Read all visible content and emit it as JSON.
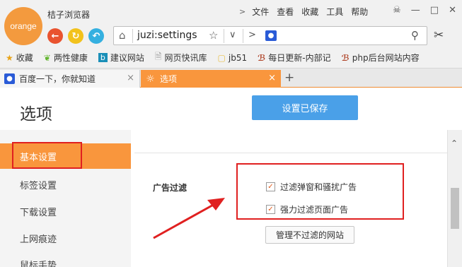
{
  "app": {
    "logo_text": "orange",
    "title": "桔子浏览器"
  },
  "menu": {
    "items": [
      "文件",
      "查看",
      "收藏",
      "工具",
      "帮助"
    ]
  },
  "address_bar": {
    "url": "juzi:settings",
    "search_placeholder": ""
  },
  "bookmarks": [
    {
      "label": "收藏",
      "icon": "star-icon",
      "color": "#e8a317"
    },
    {
      "label": "两性健康",
      "icon": "leaf-icon",
      "color": "#63b52f"
    },
    {
      "label": "建议网站",
      "icon": "bing-icon",
      "color": "#1a8fb8"
    },
    {
      "label": "网页快讯库",
      "icon": "page-icon",
      "color": "#999999"
    },
    {
      "label": "jb51",
      "icon": "folder-icon",
      "color": "#e8c04a"
    },
    {
      "label": "每日更新-内部记",
      "icon": "dedecms-icon",
      "color": "#b0452a"
    },
    {
      "label": "php后台网站内容",
      "icon": "dedecms-icon",
      "color": "#b0452a"
    }
  ],
  "tabs": [
    {
      "label": "百度一下，你就知道",
      "active": false
    },
    {
      "label": "选项",
      "active": true
    }
  ],
  "page": {
    "title": "选项",
    "saved_button": "设置已保存"
  },
  "sidebar": {
    "items": [
      {
        "label": "基本设置",
        "active": true
      },
      {
        "label": "标签设置",
        "active": false
      },
      {
        "label": "下载设置",
        "active": false
      },
      {
        "label": "上网痕迹",
        "active": false
      },
      {
        "label": "鼠标手势",
        "active": false
      }
    ]
  },
  "ad_filter": {
    "section_label": "广告过滤",
    "options": [
      {
        "label": "过滤弹窗和骚扰广告",
        "checked": true
      },
      {
        "label": "强力过滤页面广告",
        "checked": true
      }
    ],
    "manage_button": "管理不过滤的网站"
  },
  "colors": {
    "accent": "#f9963d",
    "save_button": "#4aa0e8",
    "annotation": "#e02020"
  }
}
